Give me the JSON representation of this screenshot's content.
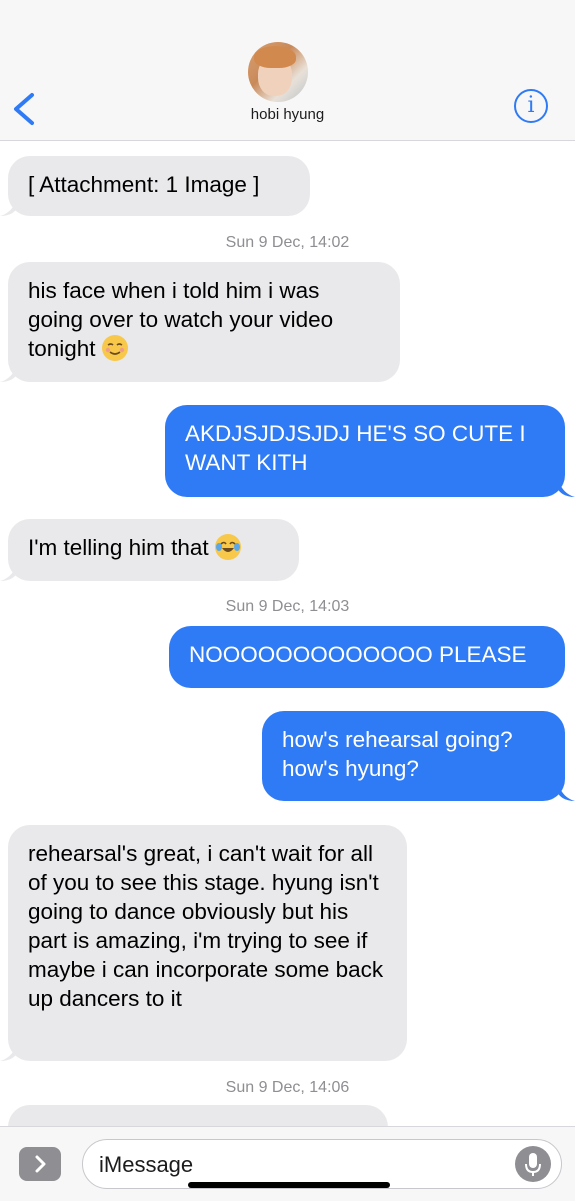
{
  "header": {
    "contact_name": "hobi hyung",
    "info_glyph": "i",
    "back_icon": "chevron-left-icon",
    "accent_color": "#2f7bf5"
  },
  "messages": [
    {
      "side": "received",
      "text": "[ Attachment: 1 Image ]"
    },
    {
      "side": "received",
      "text": "his face when i told him i was going over to watch your video tonight",
      "emoji": "relieved-face-emoji"
    },
    {
      "side": "sent",
      "text": "AKDJSJDJSJDJ HE'S SO CUTE I WANT KITH"
    },
    {
      "side": "received",
      "text": "I'm telling him that",
      "emoji": "tears-of-joy-emoji"
    },
    {
      "side": "sent",
      "text": "NOOOOOOOOOOOOO PLEASE"
    },
    {
      "side": "sent",
      "text": "how's rehearsal going? how's hyung?"
    },
    {
      "side": "received",
      "text": "rehearsal's great, i can't wait for all of you to see this stage. hyung isn't going to dance obviously but his part is amazing, i'm trying to see if maybe i can incorporate some back up dancers to it"
    }
  ],
  "timestamps": [
    "Sun 9 Dec, 14:02",
    "Sun 9 Dec, 14:03",
    "Sun 9 Dec, 14:06"
  ],
  "input": {
    "placeholder": "iMessage",
    "apps_icon": "app-drawer-chevron-icon",
    "mic_icon": "microphone-icon"
  },
  "colors": {
    "sent_bubble": "#2f7bf5",
    "received_bubble": "#e9e9eb",
    "timestamp": "#8e8e93"
  }
}
